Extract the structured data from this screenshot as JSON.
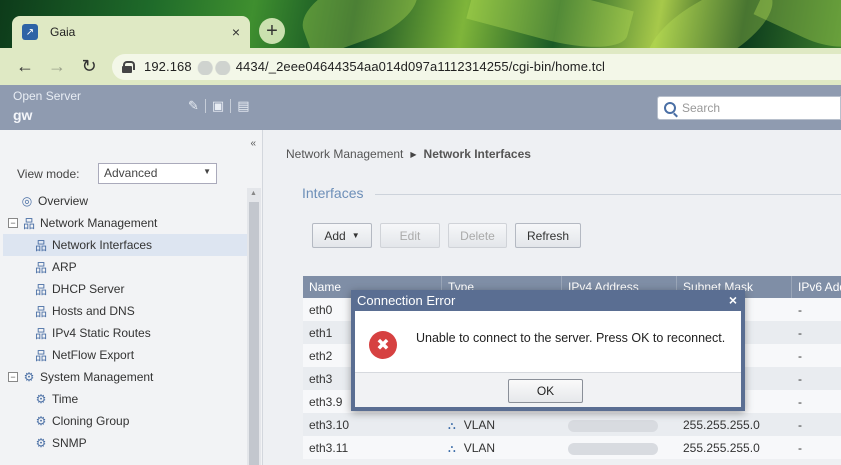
{
  "browser": {
    "tab_title": "Gaia",
    "tab_close": "×",
    "new_tab": "+",
    "back": "←",
    "forward": "→",
    "reload": "↻",
    "url_prefix": "192.168",
    "url_suffix": "4434/_2eee04644354aa014d097a1112314255/cgi-bin/home.tcl"
  },
  "header": {
    "app_name": "Open Server",
    "hostname": "gw",
    "icons": [
      "wrench-icon",
      "terminal-icon",
      "document-icon"
    ],
    "search_placeholder": "Search"
  },
  "sidebar": {
    "collapse": "«",
    "view_mode_label": "View mode:",
    "view_mode_value": "Advanced",
    "items": [
      {
        "label": "Overview",
        "icon": "overview-icon",
        "level": 0,
        "expander": ""
      },
      {
        "label": "Network Management",
        "icon": "network-icon",
        "level": 0,
        "expander": "−"
      },
      {
        "label": "Network Interfaces",
        "icon": "network-icon",
        "level": 1,
        "selected": true
      },
      {
        "label": "ARP",
        "icon": "network-icon",
        "level": 1
      },
      {
        "label": "DHCP Server",
        "icon": "network-icon",
        "level": 1
      },
      {
        "label": "Hosts and DNS",
        "icon": "network-icon",
        "level": 1
      },
      {
        "label": "IPv4 Static Routes",
        "icon": "network-icon",
        "level": 1
      },
      {
        "label": "NetFlow Export",
        "icon": "network-icon",
        "level": 1
      },
      {
        "label": "System Management",
        "icon": "gear-icon",
        "level": 0,
        "expander": "−"
      },
      {
        "label": "Time",
        "icon": "gear-icon",
        "level": 1
      },
      {
        "label": "Cloning Group",
        "icon": "gear-icon",
        "level": 1
      },
      {
        "label": "SNMP",
        "icon": "gear-icon",
        "level": 1
      }
    ]
  },
  "main": {
    "breadcrumb": [
      "Network Management",
      "Network Interfaces"
    ],
    "section_title": "Interfaces",
    "buttons": {
      "add": "Add",
      "edit": "Edit",
      "delete": "Delete",
      "refresh": "Refresh"
    },
    "columns": [
      "Name",
      "Type",
      "IPv4 Address",
      "Subnet Mask",
      "IPv6 Add"
    ],
    "rows": [
      {
        "name": "eth0",
        "type": "",
        "ipv4": "",
        "mask": ".248",
        "ipv6": "-"
      },
      {
        "name": "eth1",
        "type": "",
        "ipv4": "",
        "mask": ".0",
        "ipv6": "-"
      },
      {
        "name": "eth2",
        "type": "",
        "ipv4": "",
        "mask": ".0",
        "ipv6": "-"
      },
      {
        "name": "eth3",
        "type": "",
        "ipv4": "",
        "mask": "",
        "ipv6": "-"
      },
      {
        "name": "eth3.9",
        "type": "",
        "ipv4": "",
        "mask": ".248",
        "ipv6": "-"
      },
      {
        "name": "eth3.10",
        "type": "VLAN",
        "ipv4": "",
        "mask": "255.255.255.0",
        "ipv6": "-"
      },
      {
        "name": "eth3.11",
        "type": "VLAN",
        "ipv4": "",
        "mask": "255.255.255.0",
        "ipv6": "-"
      }
    ]
  },
  "dialog": {
    "title": "Connection Error",
    "close": "×",
    "message": "Unable to connect to the server. Press OK to reconnect.",
    "ok_label": "OK"
  }
}
